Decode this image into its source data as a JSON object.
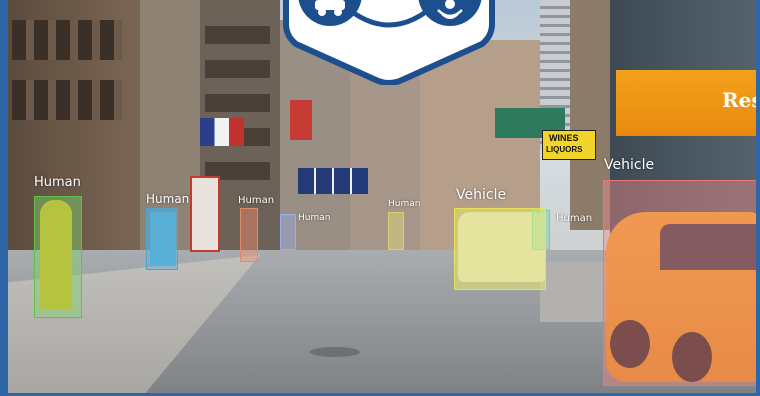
{
  "detections": [
    {
      "label": "Human",
      "kind": "human"
    },
    {
      "label": "Human",
      "kind": "human"
    },
    {
      "label": "Human",
      "kind": "human"
    },
    {
      "label": "Human",
      "kind": "human"
    },
    {
      "label": "Human",
      "kind": "human"
    },
    {
      "label": "Human",
      "kind": "human"
    },
    {
      "label": "Vehicle",
      "kind": "vehicle"
    },
    {
      "label": "Vehicle",
      "kind": "vehicle"
    }
  ],
  "signs": {
    "wines": "WINES",
    "liquors": "LIQUORS",
    "restaurant": "Res"
  },
  "badge": {
    "left_icon": "car-icon",
    "right_icon": "person-wave-icon"
  },
  "colors": {
    "frame": "#2f66a8",
    "badge": "#1d4f8f",
    "human_box": "#7fd46b",
    "vehicle_box": "#f0f06a",
    "taxi_box": "#f08a8a"
  }
}
